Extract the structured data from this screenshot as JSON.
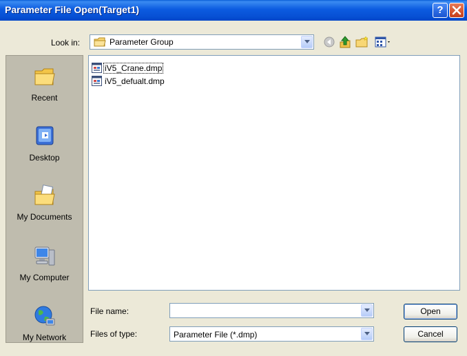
{
  "window": {
    "title": "Parameter File Open(Target1)",
    "help_label": "?",
    "close_label": "✕"
  },
  "lookin": {
    "label": "Look in:",
    "value": "Parameter Group"
  },
  "toolbar": {
    "icons": [
      "back-icon",
      "up-folder-icon",
      "new-folder-icon",
      "view-menu-icon"
    ]
  },
  "places": [
    {
      "label": "Recent",
      "icon": "recent-icon"
    },
    {
      "label": "Desktop",
      "icon": "desktop-icon"
    },
    {
      "label": "My Documents",
      "icon": "my-documents-icon"
    },
    {
      "label": "My Computer",
      "icon": "my-computer-icon"
    },
    {
      "label": "My Network",
      "icon": "my-network-icon"
    }
  ],
  "files": [
    {
      "name": "iV5_Crane.dmp",
      "icon": "dmp-file-icon"
    },
    {
      "name": "iV5_defualt.dmp",
      "icon": "dmp-file-icon"
    }
  ],
  "fields": {
    "filename_label": "File name:",
    "filename_value": "",
    "filetype_label": "Files of type:",
    "filetype_value": "Parameter File (*.dmp)"
  },
  "buttons": {
    "open": "Open",
    "cancel": "Cancel"
  },
  "colors": {
    "titlebar": "#0C5BE0",
    "dialog_bg": "#ECE9D8",
    "places_bg": "#BFBCAE",
    "field_border": "#7F9DB9"
  }
}
